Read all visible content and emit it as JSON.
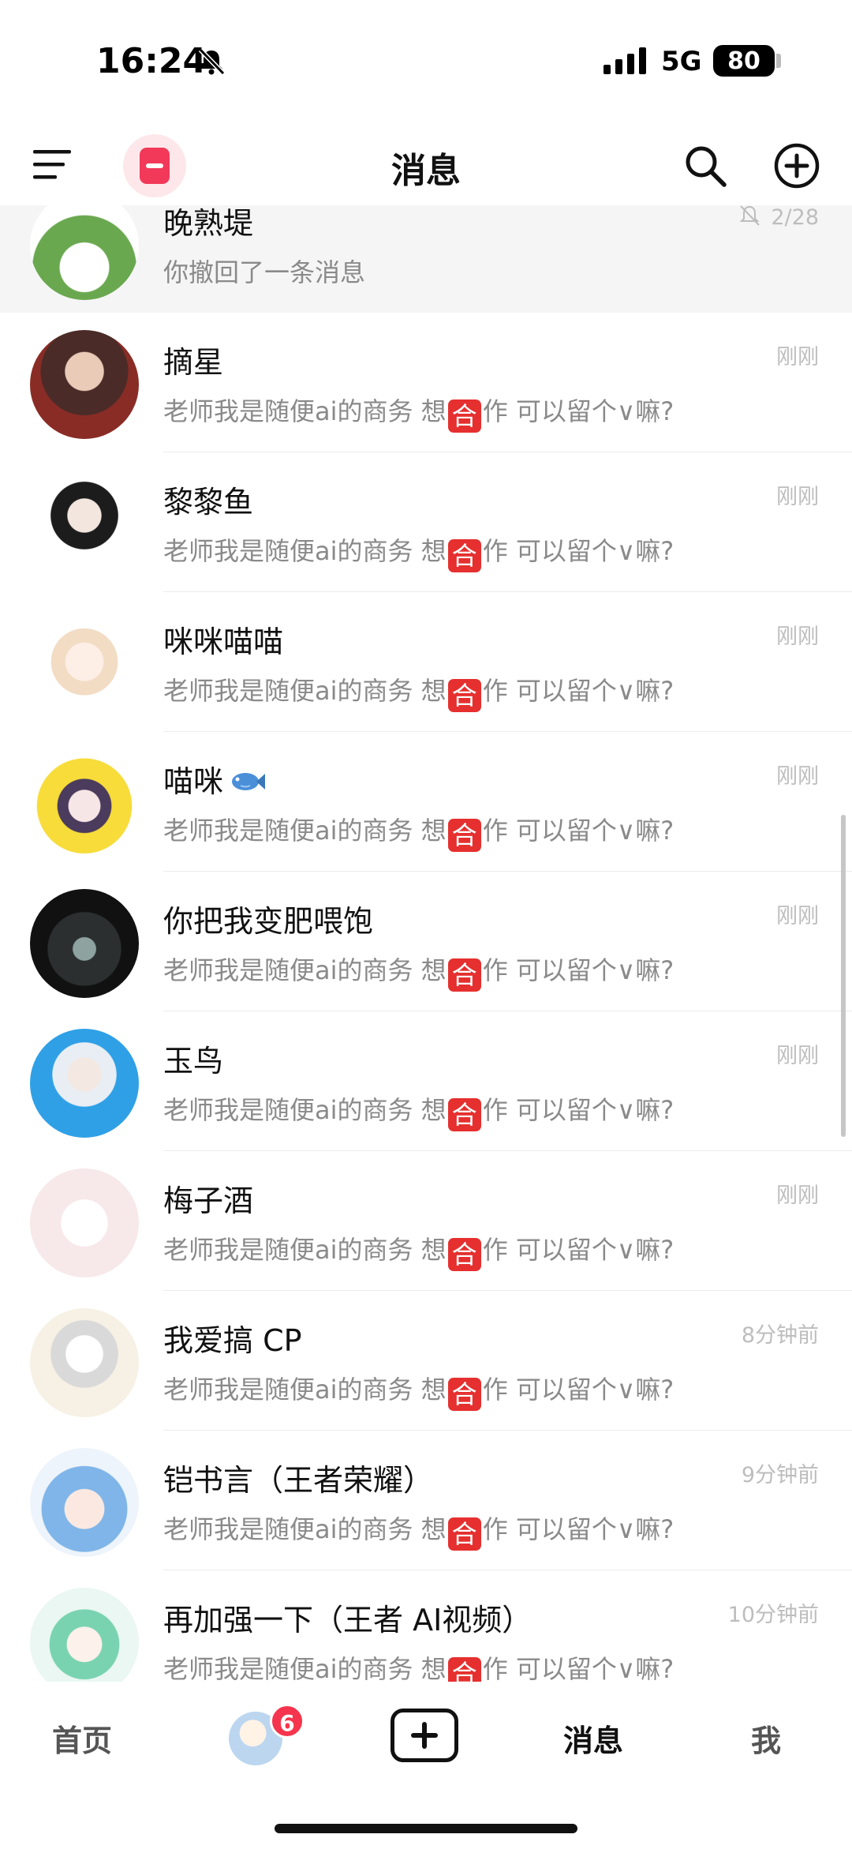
{
  "status_bar": {
    "time": "16:24",
    "network": "5G",
    "battery": "80"
  },
  "header": {
    "title": "消息"
  },
  "conversations": [
    {
      "name": "晚熟堤",
      "preview": "你撤回了一条消息",
      "time": "2/28",
      "muted": true,
      "pinned": true,
      "avatar": "avatar-broccoli"
    },
    {
      "name": "摘星",
      "preview_before": "老师我是随便ai的商务 想",
      "preview_highlight": "合",
      "preview_after": "作 可以留个∨嘛?",
      "time": "刚刚",
      "avatar": "avatar-man-red"
    },
    {
      "name": "黎黎鱼",
      "preview_before": "老师我是随便ai的商务 想",
      "preview_highlight": "合",
      "preview_after": "作 可以留个∨嘛?",
      "time": "刚刚",
      "avatar": "avatar-anime-boy"
    },
    {
      "name": "咪咪喵喵",
      "preview_before": "老师我是随便ai的商务 想",
      "preview_highlight": "合",
      "preview_after": "作 可以留个∨嘛?",
      "time": "刚刚",
      "avatar": "avatar-chibi-bear"
    },
    {
      "name": "喵咪",
      "preview_before": "老师我是随便ai的商务 想",
      "preview_highlight": "合",
      "preview_after": "作 可以留个∨嘛?",
      "time": "刚刚",
      "avatar": "avatar-yellow-raincoat",
      "emoji": "fish-icon"
    },
    {
      "name": "你把我变肥喂饱",
      "preview_before": "老师我是随便ai的商务 想",
      "preview_highlight": "合",
      "preview_after": "作 可以留个∨嘛?",
      "time": "刚刚",
      "avatar": "avatar-glasses"
    },
    {
      "name": "玉鸟",
      "preview_before": "老师我是随便ai的商务 想",
      "preview_highlight": "合",
      "preview_after": "作 可以留个∨嘛?",
      "time": "刚刚",
      "avatar": "avatar-white-hair"
    },
    {
      "name": "梅子酒",
      "preview_before": "老师我是随便ai的商务 想",
      "preview_highlight": "合",
      "preview_after": "作 可以留个∨嘛?",
      "time": "刚刚",
      "avatar": "avatar-white-cat"
    },
    {
      "name": "我爱搞 CP",
      "preview_before": "老师我是随便ai的商务 想",
      "preview_highlight": "合",
      "preview_after": "作 可以留个∨嘛?",
      "time": "8分钟前",
      "avatar": "avatar-sketch-boy"
    },
    {
      "name": "铠书言（王者荣耀）",
      "preview_before": "老师我是随便ai的商务 想",
      "preview_highlight": "合",
      "preview_after": "作 可以留个∨嘛?",
      "time": "9分钟前",
      "avatar": "avatar-blue-hair"
    },
    {
      "name": "再加强一下（王者 AI视频）",
      "preview_before": "老师我是随便ai的商务 想",
      "preview_highlight": "合",
      "preview_after": "作 可以留个∨嘛?",
      "time": "10分钟前",
      "avatar": "avatar-green-hair"
    }
  ],
  "tab_bar": {
    "home": "首页",
    "friends_badge": "6",
    "messages": "消息",
    "me": "我"
  },
  "colors": {
    "accent": "#f2395a",
    "badge": "#f5354d",
    "highlight": "#e5302f"
  }
}
